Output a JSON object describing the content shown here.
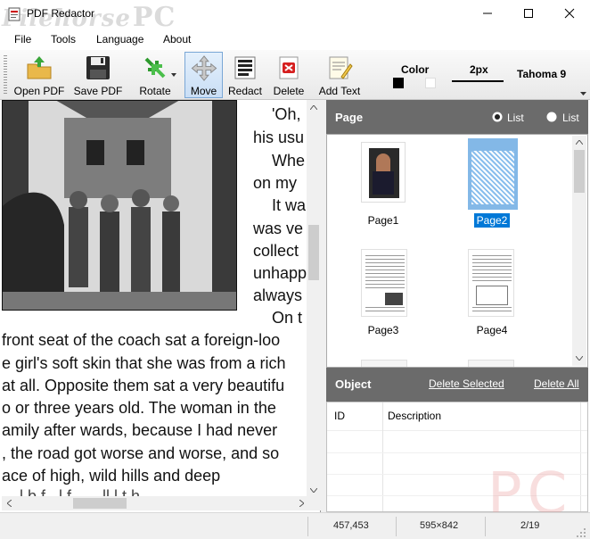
{
  "window": {
    "title": "PDF Redactor",
    "watermark": "Filehorse",
    "watermark_pc": "PC",
    "minimize": "–",
    "maximize": "☐",
    "close": "✕"
  },
  "menu": [
    "File",
    "Tools",
    "Language",
    "About"
  ],
  "toolbar": {
    "buttons": [
      "Open PDF",
      "Save PDF",
      "Rotate",
      "Move",
      "Redact",
      "Delete",
      "Add Text"
    ],
    "color_label": "Color",
    "stroke_label": "2px",
    "font_label": "Tahoma 9"
  },
  "document": {
    "lines_right": [
      "'Oh,",
      "his usu",
      "Whe",
      "on my",
      "It wa",
      "was ve",
      "collect",
      "unhapp",
      "always",
      "On t"
    ],
    "lines_full": [
      "front seat of the coach sat a foreign-loo",
      "e girl's soft skin that she was from a rich",
      "at all. Opposite them sat a very beautifu",
      "o or three years old. The woman in the",
      "amily after wards, because I had never",
      ", the road got worse and worse, and so",
      "ace of high, wild hills and deep",
      "... l   b   f   ..l  f  ..  .. ll   l t  h"
    ]
  },
  "page_panel": {
    "title": "Page",
    "radio1": "List",
    "radio2": "List",
    "pages": [
      "Page1",
      "Page2",
      "Page3",
      "Page4"
    ],
    "selected": "Page2"
  },
  "object_panel": {
    "title": "Object",
    "delete_selected": "Delete Selected",
    "delete_all": "Delete All",
    "columns": [
      "ID",
      "Description"
    ]
  },
  "status": {
    "coords": "457,453",
    "size": "595×842",
    "page": "2/19"
  }
}
